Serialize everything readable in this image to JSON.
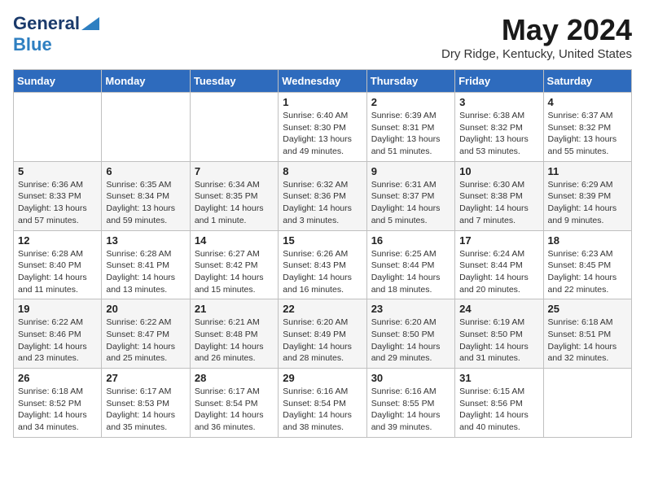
{
  "logo": {
    "line1": "General",
    "line2": "Blue"
  },
  "title": "May 2024",
  "location": "Dry Ridge, Kentucky, United States",
  "days_of_week": [
    "Sunday",
    "Monday",
    "Tuesday",
    "Wednesday",
    "Thursday",
    "Friday",
    "Saturday"
  ],
  "weeks": [
    [
      {
        "day": "",
        "info": ""
      },
      {
        "day": "",
        "info": ""
      },
      {
        "day": "",
        "info": ""
      },
      {
        "day": "1",
        "info": "Sunrise: 6:40 AM\nSunset: 8:30 PM\nDaylight: 13 hours\nand 49 minutes."
      },
      {
        "day": "2",
        "info": "Sunrise: 6:39 AM\nSunset: 8:31 PM\nDaylight: 13 hours\nand 51 minutes."
      },
      {
        "day": "3",
        "info": "Sunrise: 6:38 AM\nSunset: 8:32 PM\nDaylight: 13 hours\nand 53 minutes."
      },
      {
        "day": "4",
        "info": "Sunrise: 6:37 AM\nSunset: 8:32 PM\nDaylight: 13 hours\nand 55 minutes."
      }
    ],
    [
      {
        "day": "5",
        "info": "Sunrise: 6:36 AM\nSunset: 8:33 PM\nDaylight: 13 hours\nand 57 minutes."
      },
      {
        "day": "6",
        "info": "Sunrise: 6:35 AM\nSunset: 8:34 PM\nDaylight: 13 hours\nand 59 minutes."
      },
      {
        "day": "7",
        "info": "Sunrise: 6:34 AM\nSunset: 8:35 PM\nDaylight: 14 hours\nand 1 minute."
      },
      {
        "day": "8",
        "info": "Sunrise: 6:32 AM\nSunset: 8:36 PM\nDaylight: 14 hours\nand 3 minutes."
      },
      {
        "day": "9",
        "info": "Sunrise: 6:31 AM\nSunset: 8:37 PM\nDaylight: 14 hours\nand 5 minutes."
      },
      {
        "day": "10",
        "info": "Sunrise: 6:30 AM\nSunset: 8:38 PM\nDaylight: 14 hours\nand 7 minutes."
      },
      {
        "day": "11",
        "info": "Sunrise: 6:29 AM\nSunset: 8:39 PM\nDaylight: 14 hours\nand 9 minutes."
      }
    ],
    [
      {
        "day": "12",
        "info": "Sunrise: 6:28 AM\nSunset: 8:40 PM\nDaylight: 14 hours\nand 11 minutes."
      },
      {
        "day": "13",
        "info": "Sunrise: 6:28 AM\nSunset: 8:41 PM\nDaylight: 14 hours\nand 13 minutes."
      },
      {
        "day": "14",
        "info": "Sunrise: 6:27 AM\nSunset: 8:42 PM\nDaylight: 14 hours\nand 15 minutes."
      },
      {
        "day": "15",
        "info": "Sunrise: 6:26 AM\nSunset: 8:43 PM\nDaylight: 14 hours\nand 16 minutes."
      },
      {
        "day": "16",
        "info": "Sunrise: 6:25 AM\nSunset: 8:44 PM\nDaylight: 14 hours\nand 18 minutes."
      },
      {
        "day": "17",
        "info": "Sunrise: 6:24 AM\nSunset: 8:44 PM\nDaylight: 14 hours\nand 20 minutes."
      },
      {
        "day": "18",
        "info": "Sunrise: 6:23 AM\nSunset: 8:45 PM\nDaylight: 14 hours\nand 22 minutes."
      }
    ],
    [
      {
        "day": "19",
        "info": "Sunrise: 6:22 AM\nSunset: 8:46 PM\nDaylight: 14 hours\nand 23 minutes."
      },
      {
        "day": "20",
        "info": "Sunrise: 6:22 AM\nSunset: 8:47 PM\nDaylight: 14 hours\nand 25 minutes."
      },
      {
        "day": "21",
        "info": "Sunrise: 6:21 AM\nSunset: 8:48 PM\nDaylight: 14 hours\nand 26 minutes."
      },
      {
        "day": "22",
        "info": "Sunrise: 6:20 AM\nSunset: 8:49 PM\nDaylight: 14 hours\nand 28 minutes."
      },
      {
        "day": "23",
        "info": "Sunrise: 6:20 AM\nSunset: 8:50 PM\nDaylight: 14 hours\nand 29 minutes."
      },
      {
        "day": "24",
        "info": "Sunrise: 6:19 AM\nSunset: 8:50 PM\nDaylight: 14 hours\nand 31 minutes."
      },
      {
        "day": "25",
        "info": "Sunrise: 6:18 AM\nSunset: 8:51 PM\nDaylight: 14 hours\nand 32 minutes."
      }
    ],
    [
      {
        "day": "26",
        "info": "Sunrise: 6:18 AM\nSunset: 8:52 PM\nDaylight: 14 hours\nand 34 minutes."
      },
      {
        "day": "27",
        "info": "Sunrise: 6:17 AM\nSunset: 8:53 PM\nDaylight: 14 hours\nand 35 minutes."
      },
      {
        "day": "28",
        "info": "Sunrise: 6:17 AM\nSunset: 8:54 PM\nDaylight: 14 hours\nand 36 minutes."
      },
      {
        "day": "29",
        "info": "Sunrise: 6:16 AM\nSunset: 8:54 PM\nDaylight: 14 hours\nand 38 minutes."
      },
      {
        "day": "30",
        "info": "Sunrise: 6:16 AM\nSunset: 8:55 PM\nDaylight: 14 hours\nand 39 minutes."
      },
      {
        "day": "31",
        "info": "Sunrise: 6:15 AM\nSunset: 8:56 PM\nDaylight: 14 hours\nand 40 minutes."
      },
      {
        "day": "",
        "info": ""
      }
    ]
  ]
}
